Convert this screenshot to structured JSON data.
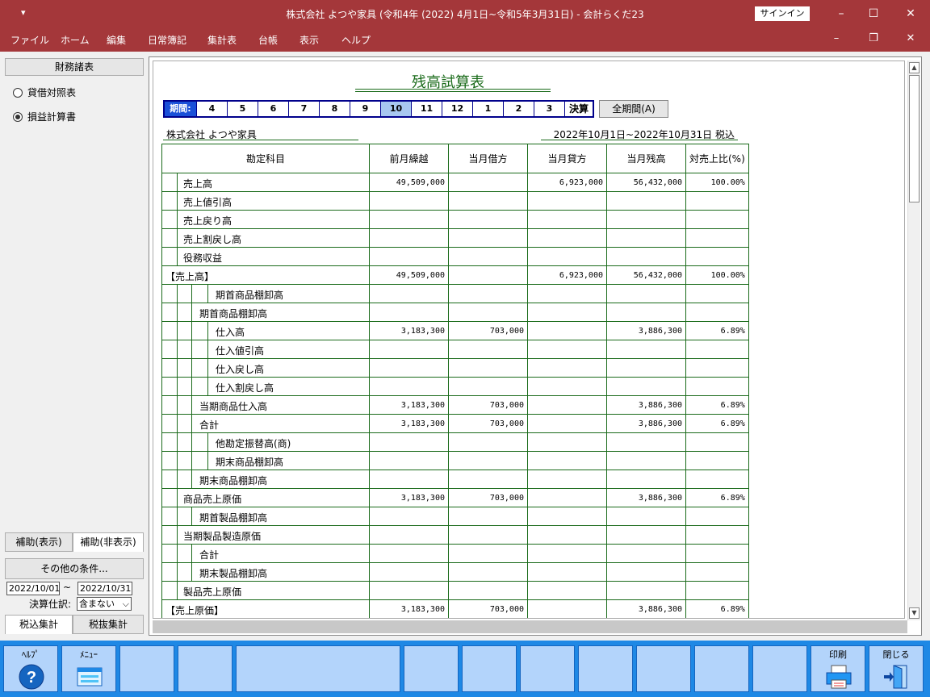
{
  "window": {
    "quick_access": "▾",
    "title": "株式会社 よつや家具 (令和4年 (2022) 4月1日~令和5年3月31日)  -  会計らくだ23",
    "signin": "サインイン"
  },
  "menu": [
    "ファイル",
    "ホーム",
    "編集",
    "日常簿記",
    "集計表",
    "台帳",
    "表示",
    "ヘルプ"
  ],
  "left": {
    "header": "財務諸表",
    "radios": [
      {
        "label": "貸借対照表",
        "selected": false
      },
      {
        "label": "損益計算書",
        "selected": true
      }
    ],
    "aux_show": "補助(表示)",
    "aux_hide": "補助(非表示)",
    "other_cond": "その他の条件...",
    "date_from": "2022/10/01",
    "tilde": "~",
    "date_to": "2022/10/31",
    "settle_label": "決算仕訳:",
    "settle_value": "含まない",
    "tax_in": "税込集計",
    "tax_out": "税抜集計"
  },
  "doc": {
    "title": "残高試算表",
    "period_label": "期間:",
    "months": [
      "4",
      "5",
      "6",
      "7",
      "8",
      "9",
      "10",
      "11",
      "12",
      "1",
      "2",
      "3"
    ],
    "current_month": "10",
    "settle": "決算",
    "all_period": "全期間(A)",
    "company": "株式会社 よつや家具",
    "date_range": "2022年10月1日~2022年10月31日  税込",
    "columns": [
      "勘定科目",
      "前月繰越",
      "当月借方",
      "当月貸方",
      "当月残高",
      "対売上比(%)"
    ],
    "rows": [
      {
        "name": "売上高",
        "indent": 1,
        "prev": "49,509,000",
        "debit": "",
        "credit": "6,923,000",
        "bal": "56,432,000",
        "pct": "100.00%"
      },
      {
        "name": "売上値引高",
        "indent": 1,
        "prev": "",
        "debit": "",
        "credit": "",
        "bal": "",
        "pct": ""
      },
      {
        "name": "売上戻り高",
        "indent": 1,
        "prev": "",
        "debit": "",
        "credit": "",
        "bal": "",
        "pct": ""
      },
      {
        "name": "売上割戻し高",
        "indent": 1,
        "prev": "",
        "debit": "",
        "credit": "",
        "bal": "",
        "pct": ""
      },
      {
        "name": "役務収益",
        "indent": 1,
        "prev": "",
        "debit": "",
        "credit": "",
        "bal": "",
        "pct": ""
      },
      {
        "name": "【売上高】",
        "indent": 0,
        "prev": "49,509,000",
        "debit": "",
        "credit": "6,923,000",
        "bal": "56,432,000",
        "pct": "100.00%"
      },
      {
        "name": "期首商品棚卸高",
        "indent": 3,
        "prev": "",
        "debit": "",
        "credit": "",
        "bal": "",
        "pct": ""
      },
      {
        "name": "期首商品棚卸高",
        "indent": 2,
        "prev": "",
        "debit": "",
        "credit": "",
        "bal": "",
        "pct": ""
      },
      {
        "name": "仕入高",
        "indent": 3,
        "prev": "3,183,300",
        "debit": "703,000",
        "credit": "",
        "bal": "3,886,300",
        "pct": "6.89%"
      },
      {
        "name": "仕入値引高",
        "indent": 3,
        "prev": "",
        "debit": "",
        "credit": "",
        "bal": "",
        "pct": ""
      },
      {
        "name": "仕入戻し高",
        "indent": 3,
        "prev": "",
        "debit": "",
        "credit": "",
        "bal": "",
        "pct": ""
      },
      {
        "name": "仕入割戻し高",
        "indent": 3,
        "prev": "",
        "debit": "",
        "credit": "",
        "bal": "",
        "pct": ""
      },
      {
        "name": "当期商品仕入高",
        "indent": 2,
        "prev": "3,183,300",
        "debit": "703,000",
        "credit": "",
        "bal": "3,886,300",
        "pct": "6.89%"
      },
      {
        "name": "合計",
        "indent": 2,
        "prev": "3,183,300",
        "debit": "703,000",
        "credit": "",
        "bal": "3,886,300",
        "pct": "6.89%"
      },
      {
        "name": "他勘定振替高(商)",
        "indent": 3,
        "prev": "",
        "debit": "",
        "credit": "",
        "bal": "",
        "pct": ""
      },
      {
        "name": "期末商品棚卸高",
        "indent": 3,
        "prev": "",
        "debit": "",
        "credit": "",
        "bal": "",
        "pct": ""
      },
      {
        "name": "期末商品棚卸高",
        "indent": 2,
        "prev": "",
        "debit": "",
        "credit": "",
        "bal": "",
        "pct": ""
      },
      {
        "name": "商品売上原価",
        "indent": 1,
        "prev": "3,183,300",
        "debit": "703,000",
        "credit": "",
        "bal": "3,886,300",
        "pct": "6.89%"
      },
      {
        "name": "期首製品棚卸高",
        "indent": 2,
        "prev": "",
        "debit": "",
        "credit": "",
        "bal": "",
        "pct": ""
      },
      {
        "name": "当期製品製造原価",
        "indent": 1,
        "prev": "",
        "debit": "",
        "credit": "",
        "bal": "",
        "pct": ""
      },
      {
        "name": "合計",
        "indent": 2,
        "prev": "",
        "debit": "",
        "credit": "",
        "bal": "",
        "pct": ""
      },
      {
        "name": "期末製品棚卸高",
        "indent": 2,
        "prev": "",
        "debit": "",
        "credit": "",
        "bal": "",
        "pct": ""
      },
      {
        "name": "製品売上原価",
        "indent": 1,
        "prev": "",
        "debit": "",
        "credit": "",
        "bal": "",
        "pct": ""
      },
      {
        "name": "【売上原価】",
        "indent": 0,
        "prev": "3,183,300",
        "debit": "703,000",
        "credit": "",
        "bal": "3,886,300",
        "pct": "6.89%"
      }
    ]
  },
  "fkeys": [
    {
      "label": "ﾍﾙﾌﾟ",
      "icon": "help-icon"
    },
    {
      "label": "ﾒﾆｭｰ",
      "icon": "menu-icon"
    },
    {
      "label": "",
      "icon": ""
    },
    {
      "label": "",
      "icon": ""
    },
    {
      "label": "",
      "icon": ""
    },
    {
      "label": "",
      "icon": ""
    },
    {
      "label": "",
      "icon": ""
    },
    {
      "label": "",
      "icon": ""
    },
    {
      "label": "",
      "icon": ""
    },
    {
      "label": "",
      "icon": ""
    },
    {
      "label": "",
      "icon": ""
    },
    {
      "label": "",
      "icon": ""
    },
    {
      "label": "印刷",
      "icon": "printer-icon"
    },
    {
      "label": "閉じる",
      "icon": "exit-door-icon"
    }
  ],
  "colors": {
    "titlebar": "#a4373a",
    "grid": "#1a6b1a",
    "fkey_bar": "#1e88e5",
    "period_current": "#a8c8f0"
  }
}
